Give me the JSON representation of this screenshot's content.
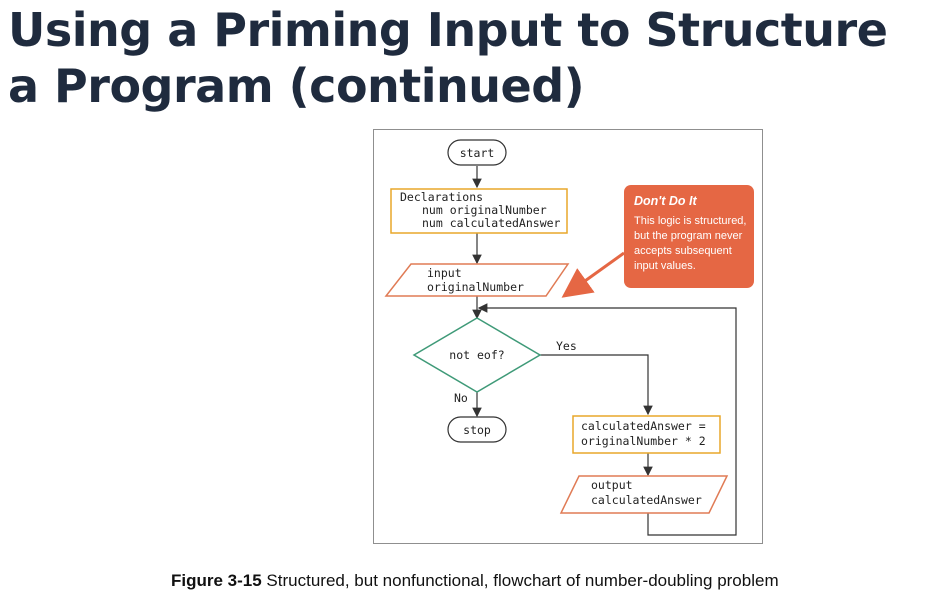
{
  "slide": {
    "title": "Using a Priming Input to Structure\na Program (continued)"
  },
  "flowchart": {
    "start": "start",
    "declarations": [
      "Declarations",
      "num originalNumber",
      "num calculatedAnswer"
    ],
    "input": [
      "input",
      "originalNumber"
    ],
    "decision": "not eof?",
    "yes_label": "Yes",
    "no_label": "No",
    "stop": "stop",
    "process": [
      "calculatedAnswer =",
      "originalNumber * 2"
    ],
    "output": [
      "output",
      "calculatedAnswer"
    ],
    "callout": {
      "title": "Don't Do It",
      "body": [
        "This logic is structured,",
        "but the program never",
        "accepts subsequent",
        "input values."
      ],
      "color": "#e56744"
    },
    "colors": {
      "process_border": "#e8a72a",
      "io_border": "#e07b55",
      "decision_border": "#3f9a78",
      "line": "#333333"
    }
  },
  "caption": {
    "label": "Figure 3-15",
    "text": " Structured, but nonfunctional, flowchart of number-doubling problem"
  }
}
